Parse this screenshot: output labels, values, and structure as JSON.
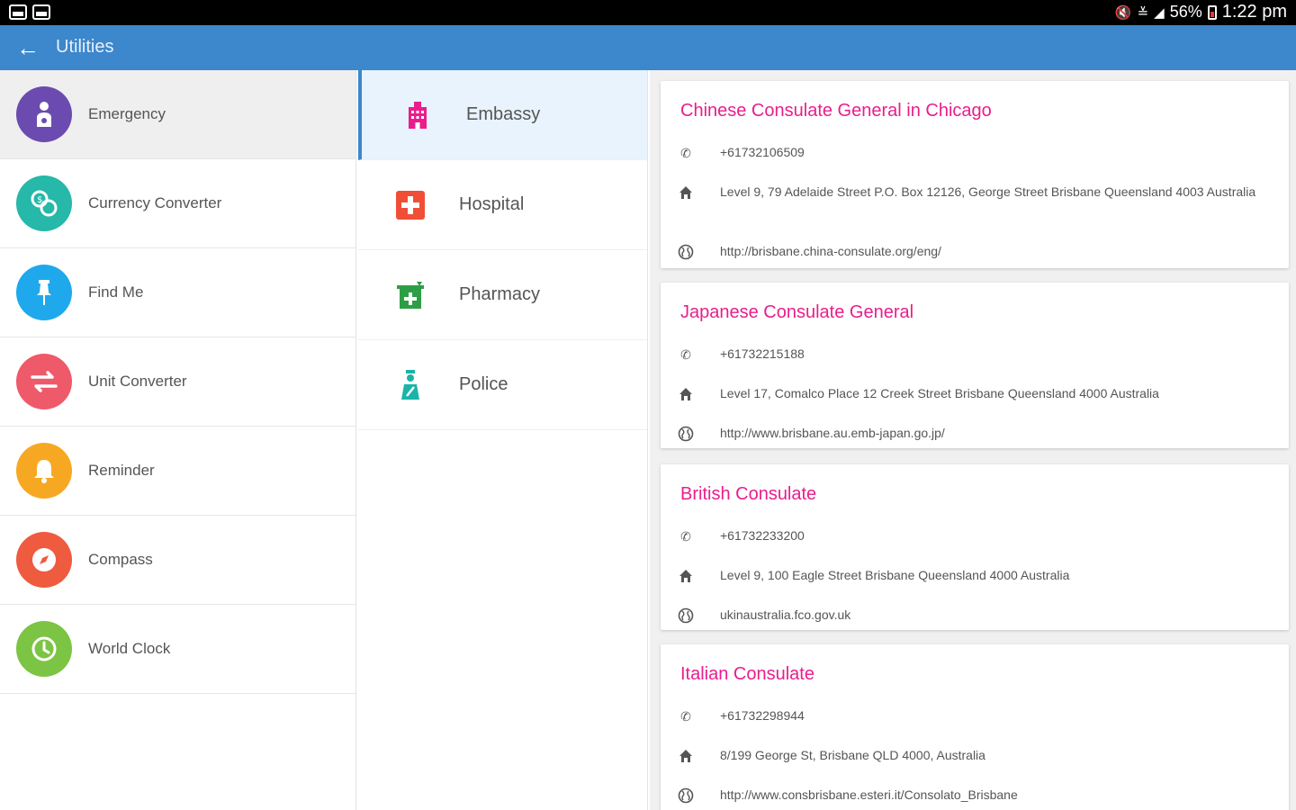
{
  "status_bar": {
    "battery": "56%",
    "time": "1:22 pm"
  },
  "app_bar": {
    "title": "Utilities"
  },
  "categories": [
    {
      "label": "Emergency",
      "icon": "emergency-icon",
      "color": "#6c4bb0"
    },
    {
      "label": "Currency Converter",
      "icon": "currency-icon",
      "color": "#26b8a8"
    },
    {
      "label": "Find Me",
      "icon": "pin-icon",
      "color": "#1fa9ec"
    },
    {
      "label": "Unit Converter",
      "icon": "swap-icon",
      "color": "#ef5a6a"
    },
    {
      "label": "Reminder",
      "icon": "bell-icon",
      "color": "#f7a823"
    },
    {
      "label": "Compass",
      "icon": "compass-icon",
      "color": "#ef5b3f"
    },
    {
      "label": "World Clock",
      "icon": "clock-icon",
      "color": "#7cc443"
    }
  ],
  "types": [
    {
      "label": "Embassy",
      "icon": "embassy-icon",
      "color": "#e91e8c"
    },
    {
      "label": "Hospital",
      "icon": "hospital-icon",
      "color": "#f04e37"
    },
    {
      "label": "Pharmacy",
      "icon": "pharmacy-icon",
      "color": "#2e9e46"
    },
    {
      "label": "Police",
      "icon": "police-icon",
      "color": "#1ab4a8"
    }
  ],
  "cards": [
    {
      "title": "Chinese Consulate General in Chicago",
      "phone": "+61732106509",
      "address": "Level 9, 79 Adelaide Street P.O. Box 12126, George Street Brisbane Queensland 4003 Australia",
      "website": "http://brisbane.china-consulate.org/eng/"
    },
    {
      "title": "Japanese Consulate General",
      "phone": "+61732215188",
      "address": "Level 17, Comalco Place 12 Creek Street Brisbane Queensland 4000 Australia",
      "website": "http://www.brisbane.au.emb-japan.go.jp/"
    },
    {
      "title": "British Consulate",
      "phone": "+61732233200",
      "address": "Level 9, 100 Eagle Street Brisbane Queensland 4000 Australia",
      "website": "ukinaustralia.fco.gov.uk"
    },
    {
      "title": "Italian Consulate",
      "phone": "+61732298944",
      "address": "8/199 George St, Brisbane QLD 4000, Australia",
      "website": "http://www.consbrisbane.esteri.it/Consolato_Brisbane"
    }
  ],
  "colors": {
    "app_bar": "#3d87cc",
    "card_title": "#e91e8c",
    "selected_type_bg": "#e8f3fd"
  }
}
